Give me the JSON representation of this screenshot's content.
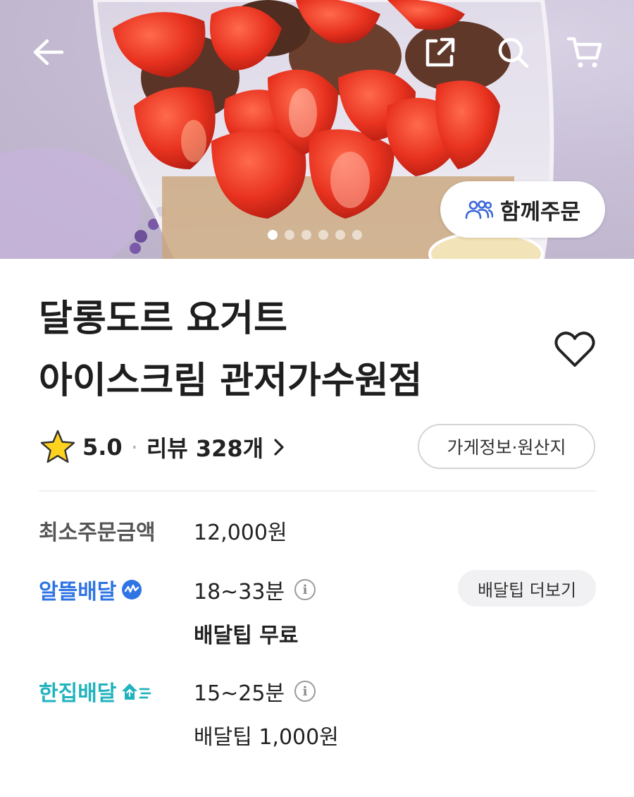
{
  "header": {
    "back_icon": "back-arrow-icon",
    "share_icon": "share-icon",
    "search_icon": "search-icon",
    "cart_icon": "cart-icon"
  },
  "hero": {
    "together_order_label": "함께주문",
    "slide_count": 6,
    "active_slide": 1
  },
  "store": {
    "name_line1": "달롱도르 요거트",
    "name_line2": "아이스크림 관저가수원점",
    "rating": "5.0",
    "review_label": "리뷰 328개",
    "store_info_button": "가게정보·원산지"
  },
  "details": {
    "min_order_label": "최소주문금액",
    "min_order_value": "12,000원",
    "saver_delivery_label": "알뜰배달",
    "saver_delivery_time": "18~33분",
    "saver_delivery_tip": "배달팁 무료",
    "tip_more_button": "배달팁 더보기",
    "single_delivery_label": "한집배달",
    "single_delivery_time": "15~25분",
    "single_delivery_tip": "배달팁 1,000원"
  },
  "colors": {
    "saver_blue": "#2f74e4",
    "single_teal": "#21b3bd",
    "star_yellow": "#ffd21f",
    "label_gray": "#555555"
  }
}
